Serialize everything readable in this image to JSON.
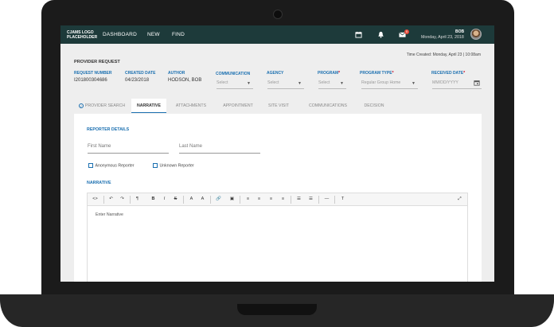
{
  "nav": {
    "logo": "CJAMS LOGO PLACEHOLDER",
    "items": [
      "DASHBOARD",
      "NEW",
      "FIND"
    ],
    "mail_count": "0",
    "user_name": "BOB",
    "user_date": "Monday, April 23, 2018"
  },
  "header": {
    "time_created": "Time Created: Monday, April 23   |   10:08am",
    "title": "PROVIDER REQUEST"
  },
  "fields": {
    "request_number": {
      "label": "REQUEST NUMBER",
      "value": "I201800304686"
    },
    "created_date": {
      "label": "CREATED DATE",
      "value": "04/23/2018"
    },
    "author": {
      "label": "AUTHOR",
      "value": "HODSON, BOB"
    },
    "communication": {
      "label": "COMMUNICATION",
      "placeholder": "Select"
    },
    "agency": {
      "label": "AGENCY",
      "placeholder": "Select"
    },
    "program": {
      "label": "PROGRAM",
      "required": "*",
      "placeholder": "Select"
    },
    "program_type": {
      "label": "PROGRAM TYPE",
      "required": "*",
      "value": "Regular Group Home"
    },
    "received_date": {
      "label": "RECEIVED DATE",
      "required": "*",
      "placeholder": "MM/DD/YYYY"
    }
  },
  "tabs": [
    {
      "label": "PROVIDER SEARCH",
      "check": "✓"
    },
    {
      "label": "NARRATIVE"
    },
    {
      "label": "ATTACHMENTS"
    },
    {
      "label": "APPOINTMENT"
    },
    {
      "label": "SITE VISIT"
    },
    {
      "label": "COMMUNICATIONS"
    },
    {
      "label": "DECISION"
    }
  ],
  "reporter": {
    "heading": "REPORTER DETAILS",
    "first_name_placeholder": "First Name",
    "last_name_placeholder": "Last Name",
    "anonymous_label": "Anonymous Reporter",
    "unknown_label": "Unknown Reporter"
  },
  "narrative": {
    "heading": "NARRATIVE",
    "placeholder": "Enter Narrative",
    "toolbar": [
      "<>",
      "↶",
      "↷",
      "¶",
      "B",
      "I",
      "S",
      "A",
      "A",
      "🔗",
      "▣",
      "≡",
      "≡",
      "≡",
      "≡",
      "☰",
      "☰",
      "—",
      "T",
      "⤢"
    ]
  },
  "colors": {
    "nav_bg": "#1d3a3a",
    "accent": "#1a6fb0",
    "required": "#d0021b"
  }
}
